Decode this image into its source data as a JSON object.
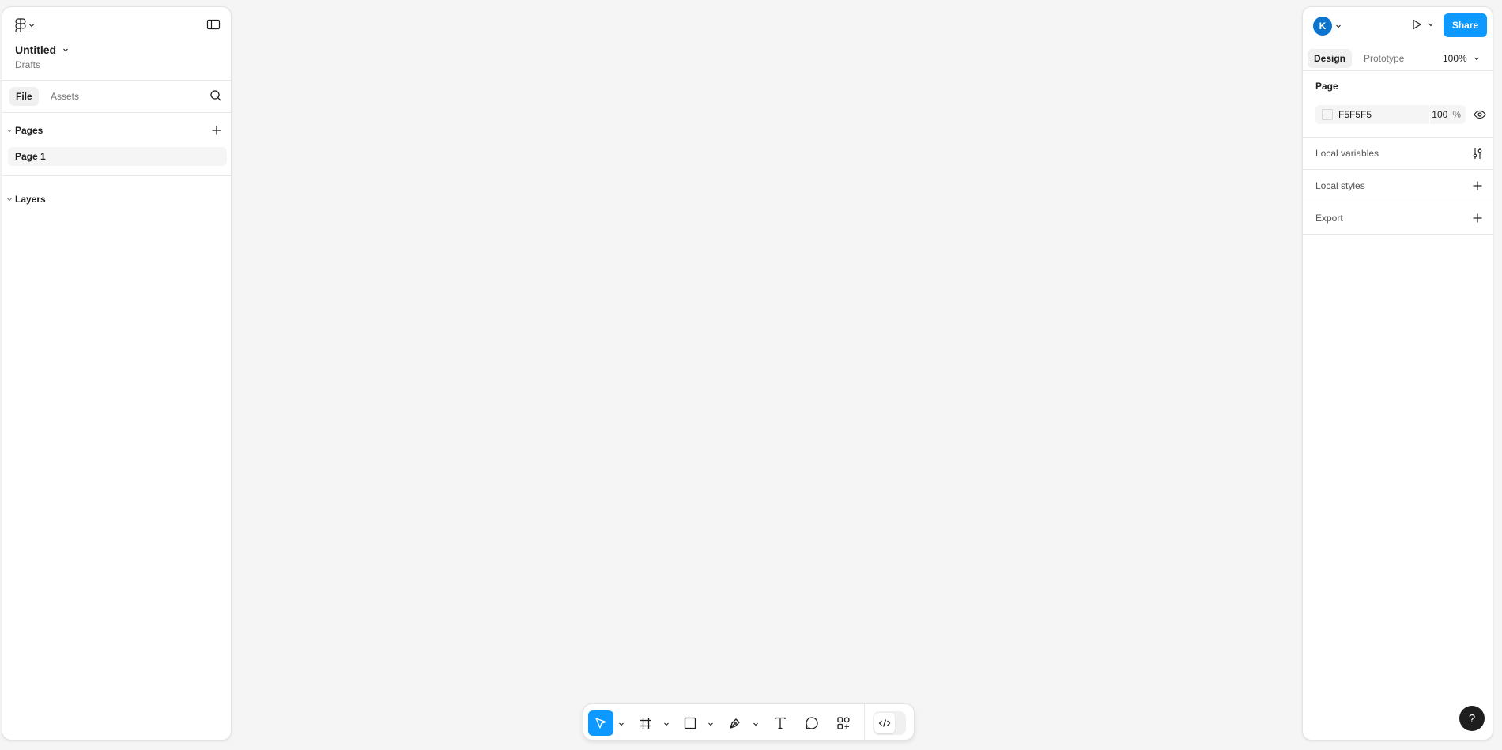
{
  "app": {
    "file_title": "Untitled",
    "file_location": "Drafts",
    "canvas_bg": "#f5f5f5",
    "accent": "#0d99ff"
  },
  "left_panel": {
    "tabs": [
      {
        "label": "File",
        "active": true
      },
      {
        "label": "Assets",
        "active": false
      }
    ],
    "pages_header": "Pages",
    "pages": [
      {
        "label": "Page 1",
        "selected": true
      }
    ],
    "layers_header": "Layers"
  },
  "right_panel": {
    "avatar_initial": "K",
    "share_label": "Share",
    "tabs": [
      {
        "label": "Design",
        "active": true
      },
      {
        "label": "Prototype",
        "active": false
      }
    ],
    "zoom": "100%",
    "page_section": {
      "title": "Page",
      "bg_color_hex": "F5F5F5",
      "opacity": "100",
      "opacity_unit": "%"
    },
    "rows": [
      {
        "label": "Local variables",
        "icon": "sliders-icon"
      },
      {
        "label": "Local styles",
        "icon": "plus-icon"
      },
      {
        "label": "Export",
        "icon": "plus-icon"
      }
    ],
    "help_label": "?"
  },
  "toolbar": {
    "tools": [
      {
        "name": "move-tool",
        "icon": "cursor-icon",
        "active": true
      },
      {
        "name": "frame-tool",
        "icon": "frame-icon",
        "active": false
      },
      {
        "name": "rectangle-tool",
        "icon": "rectangle-icon",
        "active": false
      },
      {
        "name": "pen-tool",
        "icon": "pen-icon",
        "active": false
      },
      {
        "name": "text-tool",
        "icon": "text-icon",
        "active": false
      },
      {
        "name": "comment-tool",
        "icon": "comment-icon",
        "active": false
      },
      {
        "name": "actions-tool",
        "icon": "actions-icon",
        "active": false
      }
    ],
    "dev_mode": false
  }
}
